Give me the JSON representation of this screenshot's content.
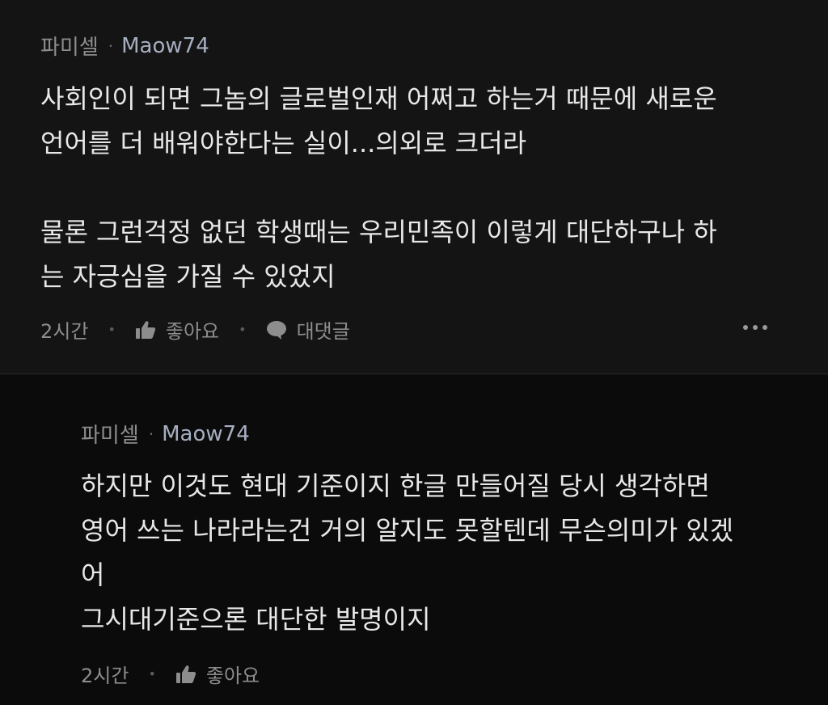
{
  "comments": [
    {
      "community": "파미셀",
      "separator": "·",
      "nickname": "Maow74",
      "lines": [
        "사회인이 되면 그놈의 글로벌인재 어쩌고 하는거 때문에 새로운",
        "언어를 더 배워야한다는 실이...의외로 크더라",
        "",
        "물론 그런걱정 없던 학생때는 우리민족이 이렇게 대단하구나 하",
        "는 자긍심을 가질 수 있었지"
      ],
      "time": "2시간",
      "like_label": "좋아요",
      "reply_label": "대댓글"
    },
    {
      "community": "파미셀",
      "separator": "·",
      "nickname": "Maow74",
      "lines": [
        "하지만 이것도 현대 기준이지 한글 만들어질 당시 생각하면",
        "영어 쓰는 나라라는건 거의 알지도 못할텐데 무슨의미가 있겠",
        "어",
        "그시대기준으론 대단한 발명이지"
      ],
      "time": "2시간",
      "like_label": "좋아요"
    }
  ],
  "colors": {
    "background": "#0e0e0e",
    "text": "#e8e8e8",
    "meta": "#8d8d8d",
    "nickname": "#a6aec0"
  },
  "icons": {
    "like": "thumbs-up-icon",
    "reply": "speech-bubble-icon",
    "more": "more-dots-icon"
  }
}
